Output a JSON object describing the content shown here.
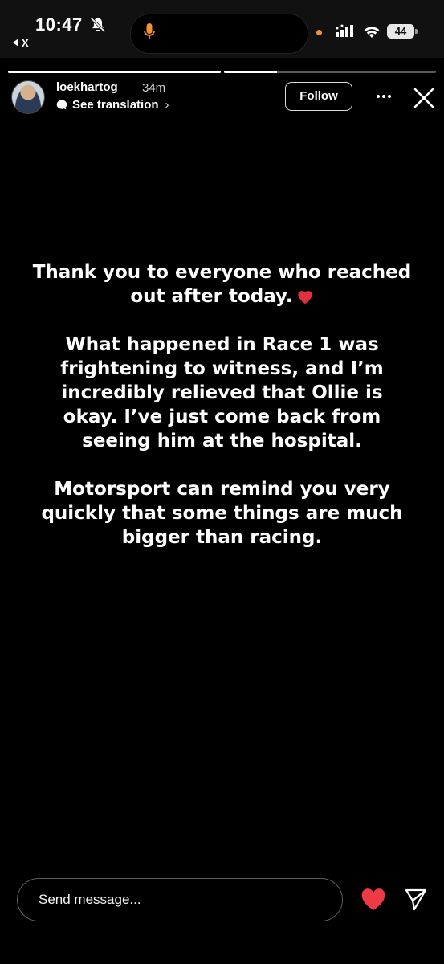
{
  "status_bar": {
    "time": "10:47",
    "back_app_label": "X",
    "battery_level": "44",
    "icons": [
      "bell-slash-icon",
      "microphone-icon",
      "signal-icon",
      "wifi-icon",
      "battery-icon"
    ],
    "accent_dot_color": "#f09433"
  },
  "story": {
    "progress": [
      1.0,
      0.25
    ],
    "username": "loekhartog_",
    "time_ago": "34m",
    "translation_link": "See translation",
    "follow_label": "Follow",
    "paragraphs": [
      "Thank you to everyone who reached out after today.",
      "What happened in Race 1 was frightening to witness, and I’m incredibly relieved that Ollie is okay. I’ve just come back from seeing him at the hospital.",
      "Motorsport can remind you very quickly that some things are much bigger than racing."
    ],
    "heart_color": "#e0303e"
  },
  "footer": {
    "message_placeholder": "Send message...",
    "like_color": "#ed3a44"
  }
}
